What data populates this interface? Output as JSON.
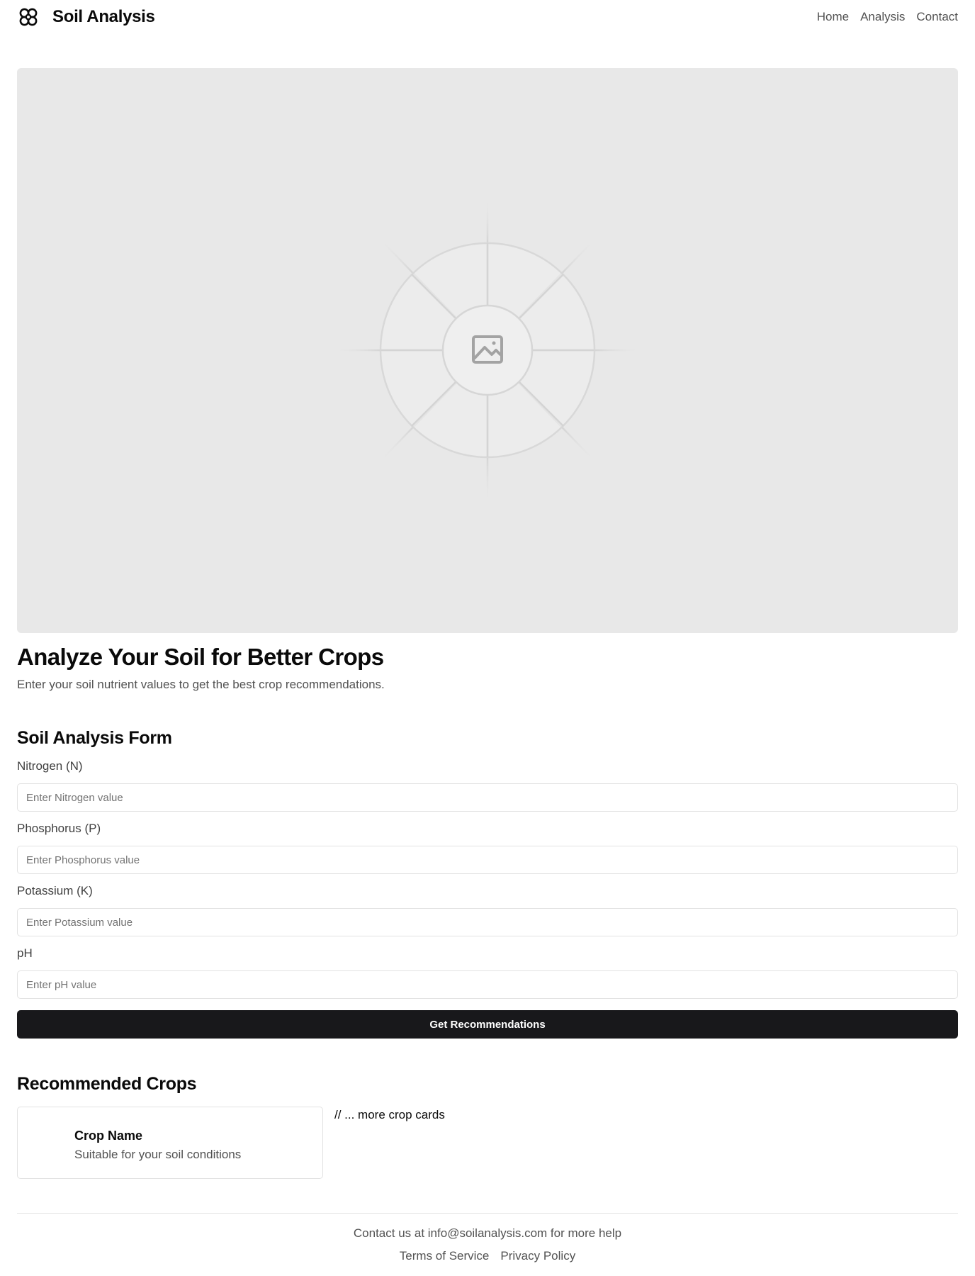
{
  "header": {
    "logo_icon": "clover-icon",
    "title": "Soil Analysis",
    "nav": [
      "Home",
      "Analysis",
      "Contact"
    ]
  },
  "hero": {
    "image_icon": "image-placeholder-icon",
    "headline": "Analyze Your Soil for Better Crops",
    "subhead": "Enter your soil nutrient values to get the best crop recommendations."
  },
  "form": {
    "title": "Soil Analysis Form",
    "fields": [
      {
        "label": "Nitrogen (N)",
        "placeholder": "Enter Nitrogen value",
        "value": ""
      },
      {
        "label": "Phosphorus (P)",
        "placeholder": "Enter Phosphorus value",
        "value": ""
      },
      {
        "label": "Potassium (K)",
        "placeholder": "Enter Potassium value",
        "value": ""
      },
      {
        "label": "pH",
        "placeholder": "Enter pH value",
        "value": ""
      }
    ],
    "submit_label": "Get Recommendations"
  },
  "crops": {
    "title": "Recommended Crops",
    "cards": [
      {
        "name": "Crop Name",
        "description": "Suitable for your soil conditions"
      }
    ],
    "more_text": "// ... more crop cards"
  },
  "footer": {
    "contact": "Contact us at info@soilanalysis.com for more help",
    "links": [
      "Terms of Service",
      "Privacy Policy"
    ]
  },
  "colors": {
    "primary_button": "#18181b",
    "hero_background": "#e8e8e8",
    "muted_text": "#525252",
    "border": "#e2e2e2"
  }
}
